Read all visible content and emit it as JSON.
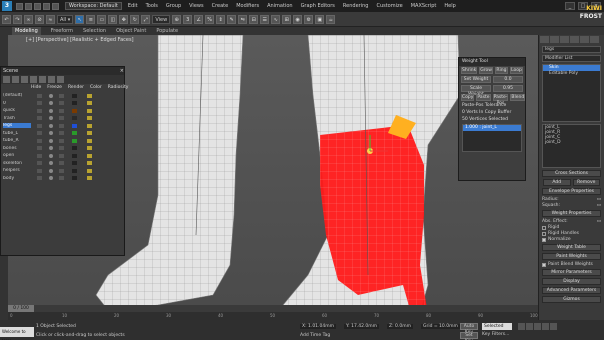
{
  "titlebar": {
    "logo": "3",
    "workspace": "Workspace: Default",
    "menus": [
      "Edit",
      "Tools",
      "Group",
      "Views",
      "Create",
      "Modifiers",
      "Animation",
      "Graph Editors",
      "Rendering",
      "Customize",
      "MAXScript",
      "Help"
    ]
  },
  "toolbar": {
    "view_select": "View"
  },
  "ribbon": {
    "tabs": [
      "Modeling",
      "Freeform",
      "Selection",
      "Object Paint",
      "Populate"
    ]
  },
  "viewport": {
    "label": "[+] [Perspective] [Realistic + Edged Faces]"
  },
  "scene_explorer": {
    "title": "Scene",
    "columns": [
      "Hide",
      "Freeze",
      "Render",
      "Color",
      "Radiosity"
    ],
    "rows": [
      {
        "name": "(default)",
        "color": "#222222"
      },
      {
        "name": "0",
        "color": "#222222"
      },
      {
        "name": "quick",
        "color": "#7a3a00"
      },
      {
        "name": "Trash",
        "color": "#2a2a2a"
      },
      {
        "name": "legs",
        "color": "#1f4fd8",
        "selected": true
      },
      {
        "name": "tube_L",
        "color": "#2a9a2a"
      },
      {
        "name": "tube_R",
        "color": "#2a9a2a"
      },
      {
        "name": "bones",
        "color": "#222222"
      },
      {
        "name": "open",
        "color": "#222222"
      },
      {
        "name": "skeleton",
        "color": "#222222"
      },
      {
        "name": "helpers",
        "color": "#222222"
      },
      {
        "name": "body",
        "color": "#222222"
      }
    ]
  },
  "weight_tool": {
    "title": "Weight Tool",
    "buttons_row1": [
      "Shrink",
      "Grow",
      "Ring",
      "Loop"
    ],
    "set_weight": "Set Weight",
    "set_weight_value": "0.0",
    "scale_weight": "Scale Weight",
    "scale_weight_value": "0.95",
    "buttons_row2": [
      "Copy",
      "Paste",
      "Paste-Pos",
      "Blend"
    ],
    "paste_pos_tol": "Paste-Pos Tolerance",
    "verts_in_buffer": "0 Verts In Copy Buffer",
    "vertices_selected": "50 Vertices Selected",
    "list_item": "1.000 : joint_L"
  },
  "command_panel": {
    "object_name": "legs",
    "modifier_list": "Modifier List",
    "stack": [
      {
        "name": "Skin",
        "selected": true
      },
      {
        "name": "Editable Poly",
        "selected": false
      }
    ],
    "bones": [
      "joint_L",
      "joint_R",
      "joint_C",
      "joint_D"
    ],
    "sections": [
      "Cross Sections",
      "Envelope Properties",
      "Weight Properties",
      "Mirror Parameters",
      "Display",
      "Advanced Parameters",
      "Gizmos"
    ],
    "add_label": "Add",
    "remove_label": "Remove",
    "radius_label": "Radius:",
    "squash_label": "Squash:",
    "abs_effect_label": "Abs. Effect:",
    "rigid_label": "Rigid",
    "rigid_handles_label": "Rigid Handles",
    "normalize_label": "Normalize",
    "weight_table_label": "Weight Table",
    "paint_weights_label": "Paint Weights",
    "paint_blend_label": "Paint Blend Weights"
  },
  "kiwi": {
    "line1": "KIWI",
    "line2": "FROST"
  },
  "timeline": {
    "frame": "0 / 100",
    "ticks": [
      "0",
      "10",
      "20",
      "30",
      "40",
      "50",
      "60",
      "70",
      "80",
      "90",
      "100"
    ]
  },
  "status": {
    "mini": "Welcome to MAX",
    "line1": "1 Object Selected",
    "line2": "Click or click-and-drag to select objects",
    "x": "X: 1.01.04mm",
    "y": "Y: 17.42.0mm",
    "z": "Z: 0.0mm",
    "grid": "Grid = 10.0mm",
    "autokey": "Auto Key",
    "selected": "Selected",
    "setkey": "Set Key",
    "keyfilters": "Key Filters...",
    "add_time_tag": "Add Time Tag"
  },
  "colors": {
    "skin_red": "#ff1a1a",
    "mesh_white": "#e6e6e6",
    "selection_blue": "#3b7bd1"
  }
}
